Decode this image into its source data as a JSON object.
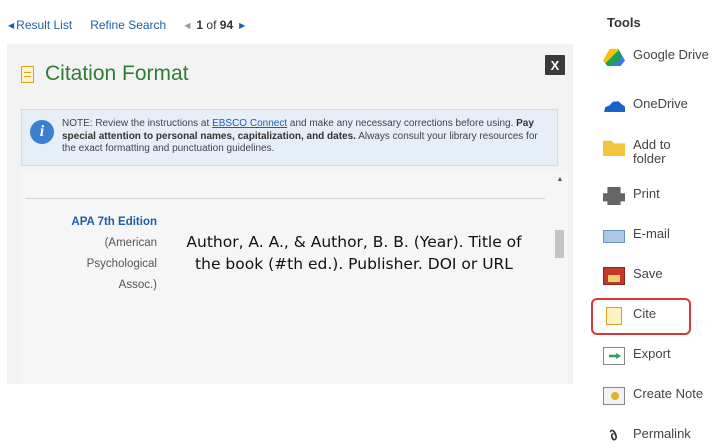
{
  "nav": {
    "result_list": "Result List",
    "refine_search": "Refine Search",
    "page_current": "1",
    "page_of": "of",
    "page_total": "94"
  },
  "panel": {
    "title": "Citation Format",
    "close": "X",
    "note": {
      "prefix": "NOTE: Review the instructions at",
      "link": "EBSCO Connect",
      "middle": "and make any necessary corrections before using.",
      "bold": "Pay special attention to personal names, capitalization, and dates.",
      "suffix": "Always consult your library resources for the exact formatting and punctuation guidelines."
    },
    "style_name": "APA 7th Edition",
    "style_desc_1": "(American",
    "style_desc_2": "Psychological",
    "style_desc_3": "Assoc.)",
    "citation": "Author, A. A., & Author, B. B. (Year). Title of the book (#th ed.). Publisher. DOI or URL"
  },
  "tools": {
    "heading": "Tools",
    "items": [
      {
        "label": "Google Drive",
        "icon": "google-drive-icon"
      },
      {
        "label": "OneDrive",
        "icon": "onedrive-icon"
      },
      {
        "label": "Add to folder",
        "icon": "folder-icon"
      },
      {
        "label": "Print",
        "icon": "printer-icon"
      },
      {
        "label": "E-mail",
        "icon": "email-icon"
      },
      {
        "label": "Save",
        "icon": "save-icon"
      },
      {
        "label": "Cite",
        "icon": "cite-icon"
      },
      {
        "label": "Export",
        "icon": "export-icon"
      },
      {
        "label": "Create Note",
        "icon": "note-icon"
      },
      {
        "label": "Permalink",
        "icon": "link-icon"
      }
    ]
  },
  "colors": {
    "link": "#1f5fa8",
    "title_green": "#2e7d32",
    "cite_highlight": "#d43a3a"
  }
}
